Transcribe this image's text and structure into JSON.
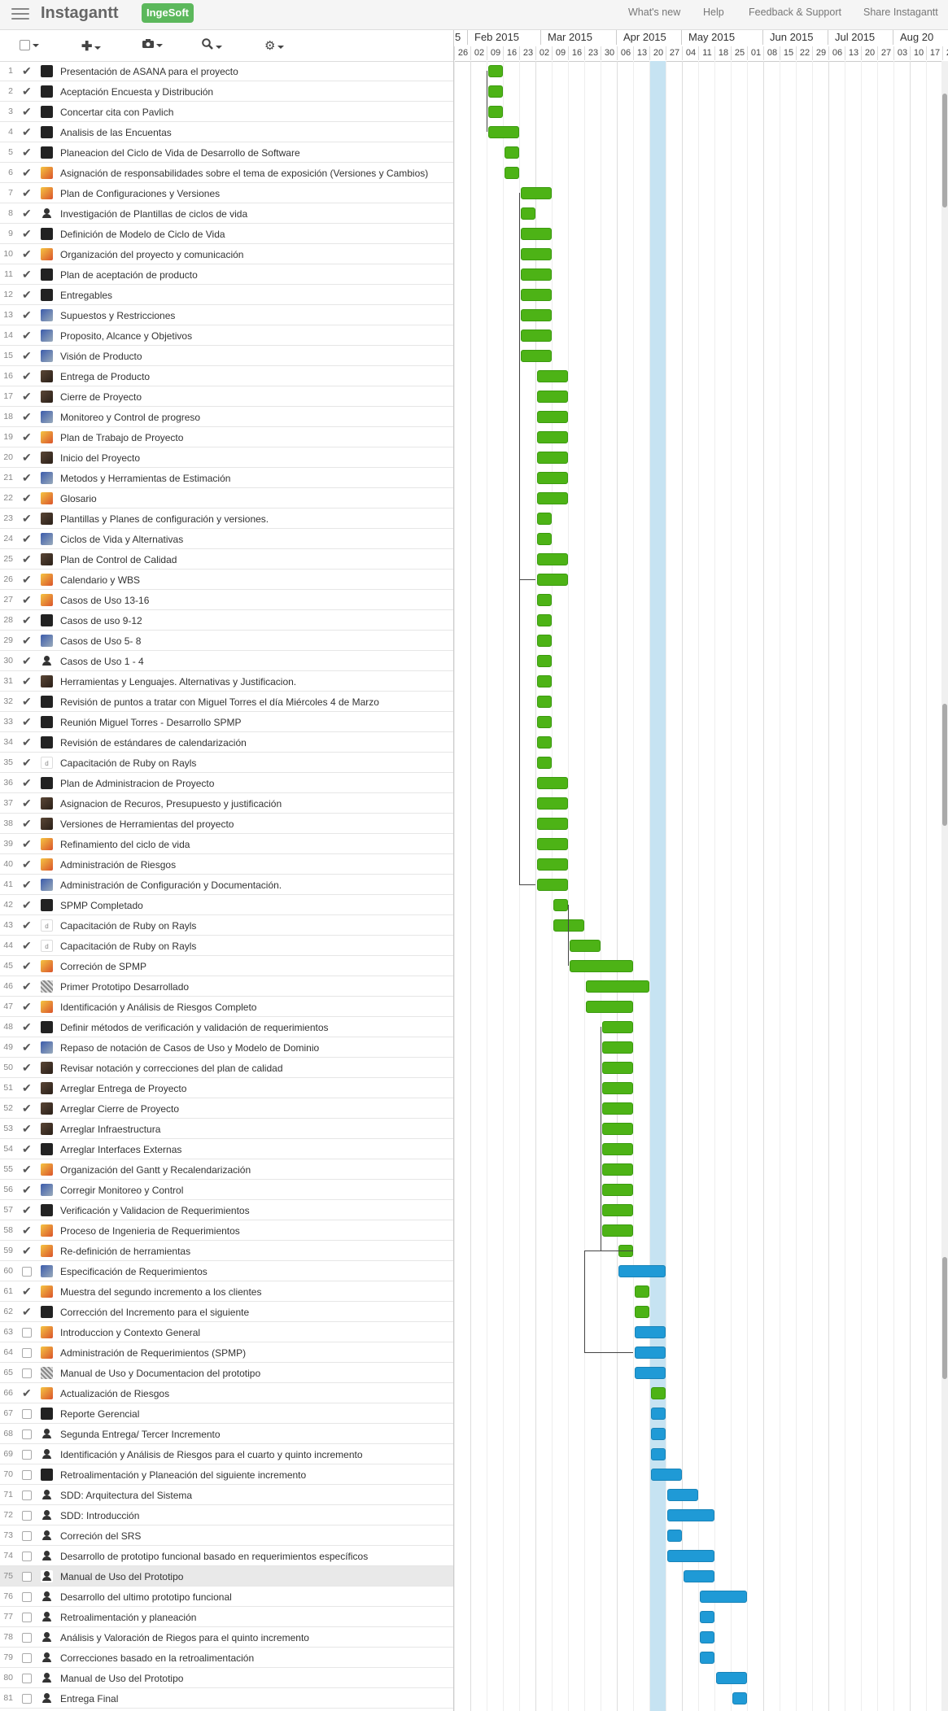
{
  "app": {
    "title": "Instagantt",
    "project_badge": "IngeSoft"
  },
  "nav": [
    {
      "label": "What's new"
    },
    {
      "label": "Help"
    },
    {
      "label": "Feedback & Support"
    },
    {
      "label": "Share Instagantt"
    }
  ],
  "toolbar": {
    "icons": [
      "select-all-checkbox",
      "add-icon",
      "camera-icon",
      "zoom-icon",
      "gear-icon"
    ]
  },
  "timeline": {
    "months": [
      "5",
      "Feb 2015",
      "Mar 2015",
      "Apr 2015",
      "May 2015",
      "Jun 2015",
      "Jul 2015",
      "Aug 20"
    ],
    "days": [
      "26",
      "02",
      "09",
      "16",
      "23",
      "02",
      "09",
      "16",
      "23",
      "30",
      "06",
      "13",
      "20",
      "27",
      "04",
      "11",
      "18",
      "25",
      "01",
      "08",
      "15",
      "22",
      "29",
      "06",
      "13",
      "20",
      "27",
      "03",
      "10",
      "17",
      "24"
    ]
  },
  "colors": {
    "done": "#4db316",
    "pending": "#1f9ad6",
    "today": "#c6e3f2"
  },
  "tasks": [
    {
      "n": "1",
      "name": "Presentación de ASANA para el proyecto",
      "done": true,
      "av": "dark",
      "start": 2,
      "dur": 1,
      "c": "g"
    },
    {
      "n": "2",
      "name": "Aceptación Encuesta y Distribución",
      "done": true,
      "av": "dark",
      "start": 2,
      "dur": 1,
      "c": "g"
    },
    {
      "n": "3",
      "name": "Concertar cita con Pavlich",
      "done": true,
      "av": "dark",
      "start": 2,
      "dur": 1,
      "c": "g"
    },
    {
      "n": "4",
      "name": "Analisis de las Encuentas",
      "done": true,
      "av": "dark",
      "start": 2,
      "dur": 2,
      "c": "g"
    },
    {
      "n": "5",
      "name": "Planeacion del Ciclo de Vida de Desarrollo de Software",
      "done": true,
      "av": "dark",
      "start": 3,
      "dur": 1,
      "c": "g"
    },
    {
      "n": "6",
      "name": "Asignación de responsabilidades sobre el tema de exposición (Versiones y Cambios)",
      "done": true,
      "av": "orange",
      "start": 3,
      "dur": 1,
      "c": "g"
    },
    {
      "n": "7",
      "name": "Plan de Configuraciones y Versiones",
      "done": true,
      "av": "orange",
      "start": 4,
      "dur": 2,
      "c": "g"
    },
    {
      "n": "8",
      "name": "Investigación de Plantillas de ciclos de vida",
      "done": true,
      "av": "person",
      "start": 4,
      "dur": 1,
      "c": "g"
    },
    {
      "n": "9",
      "name": "Definición de Modelo de Ciclo de Vida",
      "done": true,
      "av": "dark",
      "start": 4,
      "dur": 2,
      "c": "g"
    },
    {
      "n": "10",
      "name": "Organización del proyecto y comunicación",
      "done": true,
      "av": "orange",
      "start": 4,
      "dur": 2,
      "c": "g"
    },
    {
      "n": "11",
      "name": "Plan de aceptación de producto",
      "done": true,
      "av": "dark",
      "start": 4,
      "dur": 2,
      "c": "g"
    },
    {
      "n": "12",
      "name": "Entregables",
      "done": true,
      "av": "dark",
      "start": 4,
      "dur": 2,
      "c": "g"
    },
    {
      "n": "13",
      "name": "Supuestos y Restricciones",
      "done": true,
      "av": "blue",
      "start": 4,
      "dur": 2,
      "c": "g"
    },
    {
      "n": "14",
      "name": "Proposito, Alcance y Objetivos",
      "done": true,
      "av": "blue",
      "start": 4,
      "dur": 2,
      "c": "g"
    },
    {
      "n": "15",
      "name": "Visión de Producto",
      "done": true,
      "av": "blue",
      "start": 4,
      "dur": 2,
      "c": "g"
    },
    {
      "n": "16",
      "name": "Entrega de Producto",
      "done": true,
      "av": "brown",
      "start": 5,
      "dur": 2,
      "c": "g"
    },
    {
      "n": "17",
      "name": "Cierre de Proyecto",
      "done": true,
      "av": "brown",
      "start": 5,
      "dur": 2,
      "c": "g"
    },
    {
      "n": "18",
      "name": "Monitoreo y Control de progreso",
      "done": true,
      "av": "blue",
      "start": 5,
      "dur": 2,
      "c": "g"
    },
    {
      "n": "19",
      "name": "Plan de Trabajo de Proyecto",
      "done": true,
      "av": "orange",
      "start": 5,
      "dur": 2,
      "c": "g"
    },
    {
      "n": "20",
      "name": "Inicio del Proyecto",
      "done": true,
      "av": "brown",
      "start": 5,
      "dur": 2,
      "c": "g"
    },
    {
      "n": "21",
      "name": "Metodos y Herramientas de Estimación",
      "done": true,
      "av": "blue",
      "start": 5,
      "dur": 2,
      "c": "g"
    },
    {
      "n": "22",
      "name": "Glosario",
      "done": true,
      "av": "orange",
      "start": 5,
      "dur": 2,
      "c": "g"
    },
    {
      "n": "23",
      "name": "Plantillas y Planes de configuración y versiones.",
      "done": true,
      "av": "brown",
      "start": 5,
      "dur": 1,
      "c": "g"
    },
    {
      "n": "24",
      "name": "Ciclos de Vida y Alternativas",
      "done": true,
      "av": "blue",
      "start": 5,
      "dur": 1,
      "c": "g"
    },
    {
      "n": "25",
      "name": "Plan de Control de Calidad",
      "done": true,
      "av": "brown",
      "start": 5,
      "dur": 2,
      "c": "g"
    },
    {
      "n": "26",
      "name": "Calendario y WBS",
      "done": true,
      "av": "orange",
      "start": 5,
      "dur": 2,
      "c": "g"
    },
    {
      "n": "27",
      "name": "Casos de Uso 13-16",
      "done": true,
      "av": "orange",
      "start": 5,
      "dur": 1,
      "c": "g"
    },
    {
      "n": "28",
      "name": "Casos de uso 9-12",
      "done": true,
      "av": "dark",
      "start": 5,
      "dur": 1,
      "c": "g"
    },
    {
      "n": "29",
      "name": "Casos de Uso 5- 8",
      "done": true,
      "av": "blue",
      "start": 5,
      "dur": 1,
      "c": "g"
    },
    {
      "n": "30",
      "name": "Casos de Uso 1 - 4",
      "done": true,
      "av": "person",
      "start": 5,
      "dur": 1,
      "c": "g"
    },
    {
      "n": "31",
      "name": "Herramientas y Lenguajes. Alternativas y Justificacion.",
      "done": true,
      "av": "brown",
      "start": 5,
      "dur": 1,
      "c": "g"
    },
    {
      "n": "32",
      "name": "Revisión de puntos a tratar con Miguel Torres el día Miércoles 4 de Marzo",
      "done": true,
      "av": "dark",
      "start": 5,
      "dur": 1,
      "c": "g"
    },
    {
      "n": "33",
      "name": "Reunión Miguel Torres - Desarrollo SPMP",
      "done": true,
      "av": "dark",
      "start": 5,
      "dur": 1,
      "c": "g"
    },
    {
      "n": "34",
      "name": "Revisión de estándares de calendarización",
      "done": true,
      "av": "dark",
      "start": 5,
      "dur": 1,
      "c": "g"
    },
    {
      "n": "35",
      "name": "Capacitación de Ruby on Rayls",
      "done": true,
      "av": "white",
      "start": 5,
      "dur": 1,
      "c": "g"
    },
    {
      "n": "36",
      "name": "Plan de Administracion de Proyecto",
      "done": true,
      "av": "dark",
      "start": 5,
      "dur": 2,
      "c": "g"
    },
    {
      "n": "37",
      "name": "Asignacion de Recuros, Presupuesto y justificación",
      "done": true,
      "av": "brown",
      "start": 5,
      "dur": 2,
      "c": "g"
    },
    {
      "n": "38",
      "name": "Versiones de Herramientas del proyecto",
      "done": true,
      "av": "brown",
      "start": 5,
      "dur": 2,
      "c": "g"
    },
    {
      "n": "39",
      "name": "Refinamiento del ciclo de vida",
      "done": true,
      "av": "orange",
      "start": 5,
      "dur": 2,
      "c": "g"
    },
    {
      "n": "40",
      "name": "Administración de Riesgos",
      "done": true,
      "av": "orange",
      "start": 5,
      "dur": 2,
      "c": "g"
    },
    {
      "n": "41",
      "name": "Administración de Configuración y Documentación.",
      "done": true,
      "av": "blue",
      "start": 5,
      "dur": 2,
      "c": "g"
    },
    {
      "n": "42",
      "name": "SPMP Completado",
      "done": true,
      "av": "dark",
      "start": 6,
      "dur": 1,
      "c": "g"
    },
    {
      "n": "43",
      "name": "Capacitación de Ruby on Rayls",
      "done": true,
      "av": "white",
      "start": 6,
      "dur": 2,
      "c": "g"
    },
    {
      "n": "44",
      "name": "Capacitación de Ruby on Rayls",
      "done": true,
      "av": "white",
      "start": 7,
      "dur": 2,
      "c": "g"
    },
    {
      "n": "45",
      "name": "Correción de SPMP",
      "done": true,
      "av": "orange",
      "start": 7,
      "dur": 4,
      "c": "g"
    },
    {
      "n": "46",
      "name": "Primer Prototipo Desarrollado",
      "done": true,
      "av": "mono",
      "start": 8,
      "dur": 4,
      "c": "g"
    },
    {
      "n": "47",
      "name": "Identificación y Análisis de Riesgos Completo",
      "done": true,
      "av": "orange",
      "start": 8,
      "dur": 3,
      "c": "g"
    },
    {
      "n": "48",
      "name": "Definir métodos de verificación y validación de requerimientos",
      "done": true,
      "av": "dark",
      "start": 9,
      "dur": 2,
      "c": "g"
    },
    {
      "n": "49",
      "name": "Repaso de notación de Casos de Uso y Modelo de Dominio",
      "done": true,
      "av": "blue",
      "start": 9,
      "dur": 2,
      "c": "g"
    },
    {
      "n": "50",
      "name": "Revisar notación y correcciones del plan de calidad",
      "done": true,
      "av": "brown",
      "start": 9,
      "dur": 2,
      "c": "g"
    },
    {
      "n": "51",
      "name": "Arreglar Entrega de Proyecto",
      "done": true,
      "av": "brown",
      "start": 9,
      "dur": 2,
      "c": "g"
    },
    {
      "n": "52",
      "name": "Arreglar Cierre de Proyecto",
      "done": true,
      "av": "brown",
      "start": 9,
      "dur": 2,
      "c": "g"
    },
    {
      "n": "53",
      "name": "Arreglar Infraestructura",
      "done": true,
      "av": "brown",
      "start": 9,
      "dur": 2,
      "c": "g"
    },
    {
      "n": "54",
      "name": "Arreglar Interfaces Externas",
      "done": true,
      "av": "dark",
      "start": 9,
      "dur": 2,
      "c": "g"
    },
    {
      "n": "55",
      "name": "Organización del Gantt y Recalendarización",
      "done": true,
      "av": "orange",
      "start": 9,
      "dur": 2,
      "c": "g"
    },
    {
      "n": "56",
      "name": "Corregir Monitoreo y Control",
      "done": true,
      "av": "blue",
      "start": 9,
      "dur": 2,
      "c": "g"
    },
    {
      "n": "57",
      "name": "Verificación y Validacion de Requerimientos",
      "done": true,
      "av": "dark",
      "start": 9,
      "dur": 2,
      "c": "g"
    },
    {
      "n": "58",
      "name": "Proceso de Ingenieria de Requerimientos",
      "done": true,
      "av": "orange",
      "start": 9,
      "dur": 2,
      "c": "g"
    },
    {
      "n": "59",
      "name": "Re-definición de herramientas",
      "done": true,
      "av": "orange",
      "start": 10,
      "dur": 1,
      "c": "g"
    },
    {
      "n": "60",
      "name": "Especificación de Requerimientos",
      "done": false,
      "av": "blue",
      "start": 10,
      "dur": 3,
      "c": "b"
    },
    {
      "n": "61",
      "name": "Muestra del segundo incremento a los clientes",
      "done": true,
      "av": "orange",
      "start": 11,
      "dur": 1,
      "c": "g"
    },
    {
      "n": "62",
      "name": "Corrección del Incremento para el siguiente",
      "done": true,
      "av": "dark",
      "start": 11,
      "dur": 1,
      "c": "g"
    },
    {
      "n": "63",
      "name": "Introduccion y Contexto General",
      "done": false,
      "av": "orange",
      "start": 11,
      "dur": 2,
      "c": "b"
    },
    {
      "n": "64",
      "name": "Administración de Requerimientos (SPMP)",
      "done": false,
      "av": "orange",
      "start": 11,
      "dur": 2,
      "c": "b"
    },
    {
      "n": "65",
      "name": "Manual de Uso y Documentacion del prototipo",
      "done": false,
      "av": "mono",
      "start": 11,
      "dur": 2,
      "c": "b"
    },
    {
      "n": "66",
      "name": "Actualización de Riesgos",
      "done": true,
      "av": "orange",
      "start": 12,
      "dur": 1,
      "c": "g"
    },
    {
      "n": "67",
      "name": "Reporte Gerencial",
      "done": false,
      "av": "dark",
      "start": 12,
      "dur": 1,
      "c": "b"
    },
    {
      "n": "68",
      "name": "Segunda Entrega/ Tercer Incremento",
      "done": false,
      "av": "person",
      "start": 12,
      "dur": 1,
      "c": "b"
    },
    {
      "n": "69",
      "name": "Identificación y Análisis de Riesgos para el cuarto y quinto incremento",
      "done": false,
      "av": "person",
      "start": 12,
      "dur": 1,
      "c": "b"
    },
    {
      "n": "70",
      "name": "Retroalimentación y Planeación del siguiente incremento",
      "done": false,
      "av": "dark",
      "start": 12,
      "dur": 2,
      "c": "b"
    },
    {
      "n": "71",
      "name": "SDD: Arquitectura del Sistema",
      "done": false,
      "av": "person",
      "start": 13,
      "dur": 2,
      "c": "b"
    },
    {
      "n": "72",
      "name": "SDD: Introducción",
      "done": false,
      "av": "person",
      "start": 13,
      "dur": 3,
      "c": "b"
    },
    {
      "n": "73",
      "name": "Correción del SRS",
      "done": false,
      "av": "person",
      "start": 13,
      "dur": 1,
      "c": "b"
    },
    {
      "n": "74",
      "name": "Desarrollo de prototipo funcional basado en requerimientos específicos",
      "done": false,
      "av": "person",
      "start": 13,
      "dur": 3,
      "c": "b"
    },
    {
      "n": "75",
      "name": "Manual de Uso del Prototipo",
      "done": false,
      "av": "person",
      "start": 14,
      "dur": 2,
      "c": "b"
    },
    {
      "n": "76",
      "name": "Desarrollo del ultimo prototipo funcional",
      "done": false,
      "av": "person",
      "start": 15,
      "dur": 3,
      "c": "b"
    },
    {
      "n": "77",
      "name": "Retroalimentación y planeación",
      "done": false,
      "av": "person",
      "start": 15,
      "dur": 1,
      "c": "b"
    },
    {
      "n": "78",
      "name": "Análisis y Valoración de Riegos para el quinto incremento",
      "done": false,
      "av": "person",
      "start": 15,
      "dur": 1,
      "c": "b"
    },
    {
      "n": "79",
      "name": "Correcciones basado en la retroalimentación",
      "done": false,
      "av": "person",
      "start": 15,
      "dur": 1,
      "c": "b"
    },
    {
      "n": "80",
      "name": "Manual de Uso del Prototipo",
      "done": false,
      "av": "person",
      "start": 16,
      "dur": 2,
      "c": "b"
    },
    {
      "n": "81",
      "name": "Entrega Final",
      "done": false,
      "av": "person",
      "start": 17,
      "dur": 1,
      "c": "b"
    }
  ]
}
